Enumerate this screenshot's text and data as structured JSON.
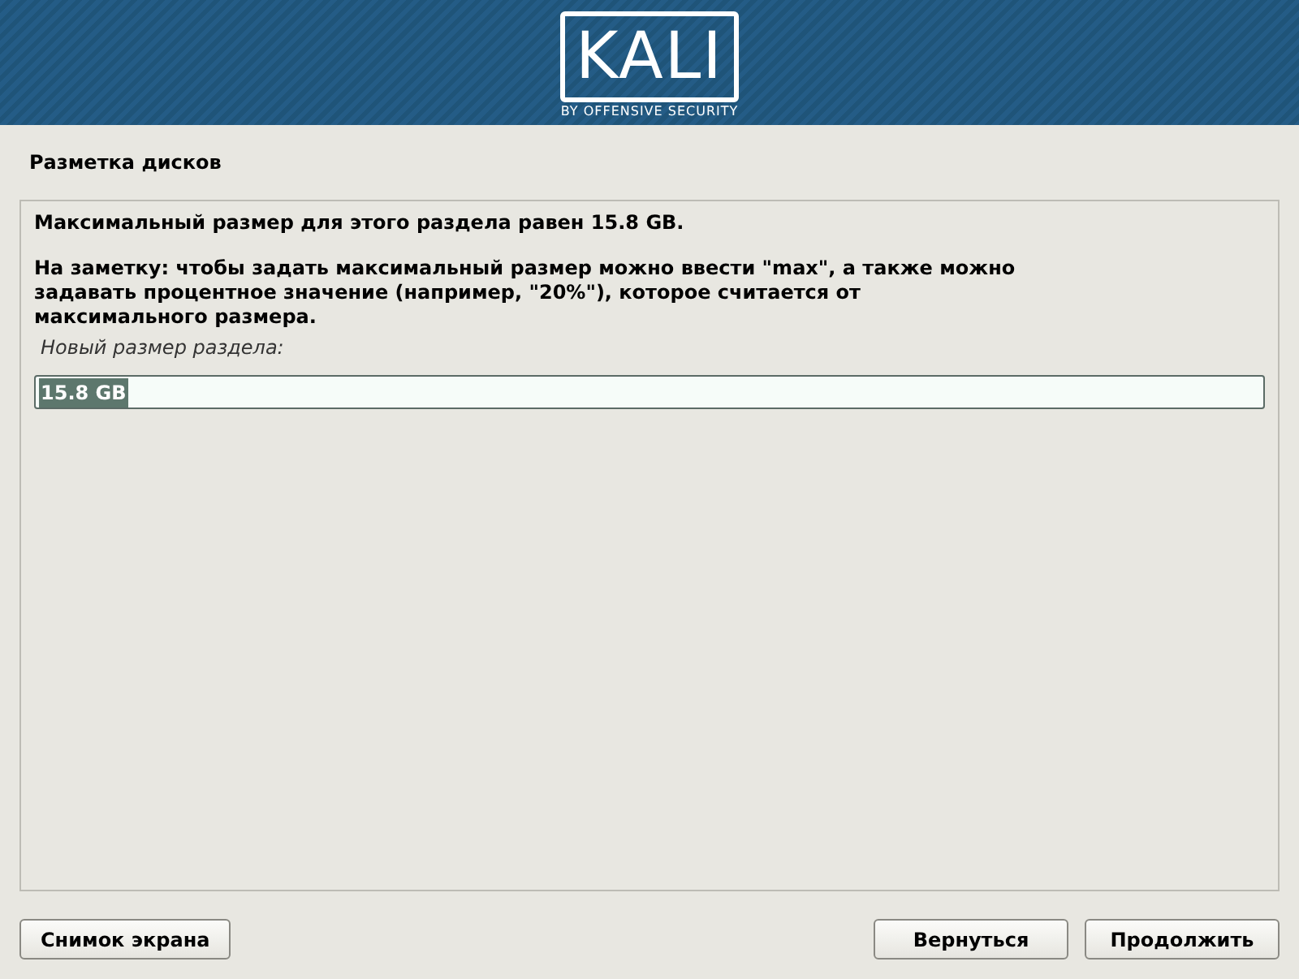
{
  "banner": {
    "logo_text": "KALI",
    "tagline": "BY OFFENSIVE SECURITY"
  },
  "title": "Разметка дисков",
  "panel": {
    "paragraphs": [
      "Максимальный размер для этого раздела равен 15.8 GB.",
      "На заметку: чтобы задать максимальный размер можно ввести \"max\", а также можно задавать процентное значение (например, \"20%\"), которое считается от максимального размера."
    ],
    "field_label": "Новый размер раздела:",
    "field": {
      "value": "15.8 GB",
      "text_selected": true
    }
  },
  "left_buttons": [
    "Снимок экрана"
  ],
  "right_buttons": [
    "Вернуться",
    "Продолжить"
  ]
}
